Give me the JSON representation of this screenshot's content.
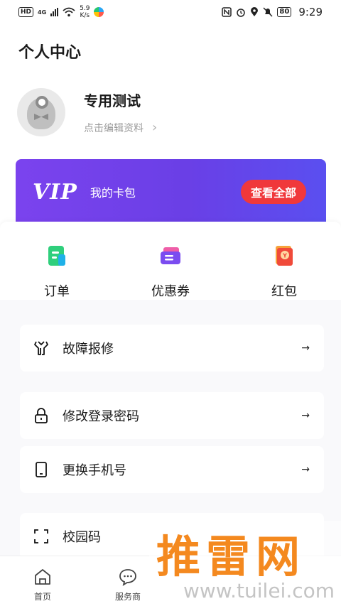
{
  "status_bar": {
    "hd": "HD",
    "network": "4G",
    "speed_value": "5.9",
    "speed_unit": "K/s",
    "battery": "80",
    "time": "9:29"
  },
  "page": {
    "title": "个人中心"
  },
  "profile": {
    "username": "专用测试",
    "edit_hint": "点击编辑资料"
  },
  "vip_card": {
    "logo": "VIP",
    "label": "我的卡包",
    "button": "查看全部"
  },
  "quick_actions": [
    {
      "label": "订单",
      "icon": "order-icon",
      "color": "#2fcf7c"
    },
    {
      "label": "优惠券",
      "icon": "coupon-icon",
      "color": "#7b4cf0"
    },
    {
      "label": "红包",
      "icon": "red-packet-icon",
      "color": "#f04a3a"
    }
  ],
  "menu": [
    {
      "label": "故障报修",
      "icon": "wrench-icon"
    },
    {
      "label": "修改登录密码",
      "icon": "lock-icon"
    },
    {
      "label": "更换手机号",
      "icon": "phone-icon"
    },
    {
      "label": "校园码",
      "icon": "scan-code-icon"
    }
  ],
  "arrow_symbol": "→",
  "tabs": [
    {
      "label": "首页",
      "icon": "home-icon"
    },
    {
      "label": "服务商",
      "icon": "chat-icon"
    }
  ],
  "watermark": {
    "title": "推雷网",
    "url": "www.tuilei.com"
  }
}
